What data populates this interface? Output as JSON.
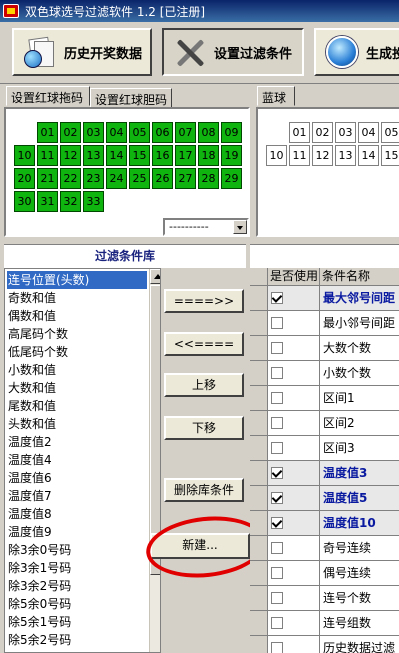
{
  "window": {
    "title": "双色球选号过滤软件 1.2 [已注册]"
  },
  "toolbar": {
    "history_label": "历史开奖数据",
    "filter_label": "设置过滤条件",
    "generate_label": "生成投"
  },
  "tabs": {
    "red_dan": "设置红球拖码",
    "red_tuo": "设置红球胆码",
    "blue": "蓝球"
  },
  "red_balls": [
    "01",
    "02",
    "03",
    "04",
    "05",
    "06",
    "07",
    "08",
    "09",
    "10",
    "11",
    "12",
    "13",
    "14",
    "15",
    "16",
    "17",
    "18",
    "19",
    "20",
    "21",
    "22",
    "23",
    "24",
    "25",
    "26",
    "27",
    "28",
    "29",
    "30",
    "31",
    "32",
    "33"
  ],
  "red_select_value": "----------",
  "blue_balls": [
    "01",
    "02",
    "03",
    "04",
    "05",
    "10",
    "11",
    "12",
    "13",
    "14",
    "15"
  ],
  "library": {
    "title": "过滤条件库",
    "items": [
      "连号位置(头数)",
      "奇数和值",
      "偶数和值",
      "高尾码个数",
      "低尾码个数",
      "小数和值",
      "大数和值",
      "尾数和值",
      "头数和值",
      "温度值2",
      "温度值4",
      "温度值6",
      "温度值7",
      "温度值8",
      "温度值9",
      "除3余0号码",
      "除3余1号码",
      "除3余2号码",
      "除5余0号码",
      "除5余1号码",
      "除5余2号码"
    ]
  },
  "buttons": {
    "add": "====>>",
    "remove": "<<====",
    "up": "上移",
    "down": "下移",
    "delete": "删除库条件",
    "new": "新建..."
  },
  "grid": {
    "col_used": "是否使用",
    "col_name": "条件名称",
    "rows": [
      {
        "name": "最大邻号间距",
        "checked": true
      },
      {
        "name": "最小邻号间距",
        "checked": false
      },
      {
        "name": "大数个数",
        "checked": false
      },
      {
        "name": "小数个数",
        "checked": false
      },
      {
        "name": "区间1",
        "checked": false
      },
      {
        "name": "区间2",
        "checked": false
      },
      {
        "name": "区间3",
        "checked": false
      },
      {
        "name": "温度值3",
        "checked": true
      },
      {
        "name": "温度值5",
        "checked": true
      },
      {
        "name": "温度值10",
        "checked": true
      },
      {
        "name": "奇号连续",
        "checked": false
      },
      {
        "name": "偶号连续",
        "checked": false
      },
      {
        "name": "连号个数",
        "checked": false
      },
      {
        "name": "连号组数",
        "checked": false
      },
      {
        "name": "历史数据过滤",
        "checked": false
      }
    ]
  },
  "colors": {
    "ball_green": "#0fb40f",
    "selection": "#316ac5",
    "annotation_red": "#e00000"
  }
}
